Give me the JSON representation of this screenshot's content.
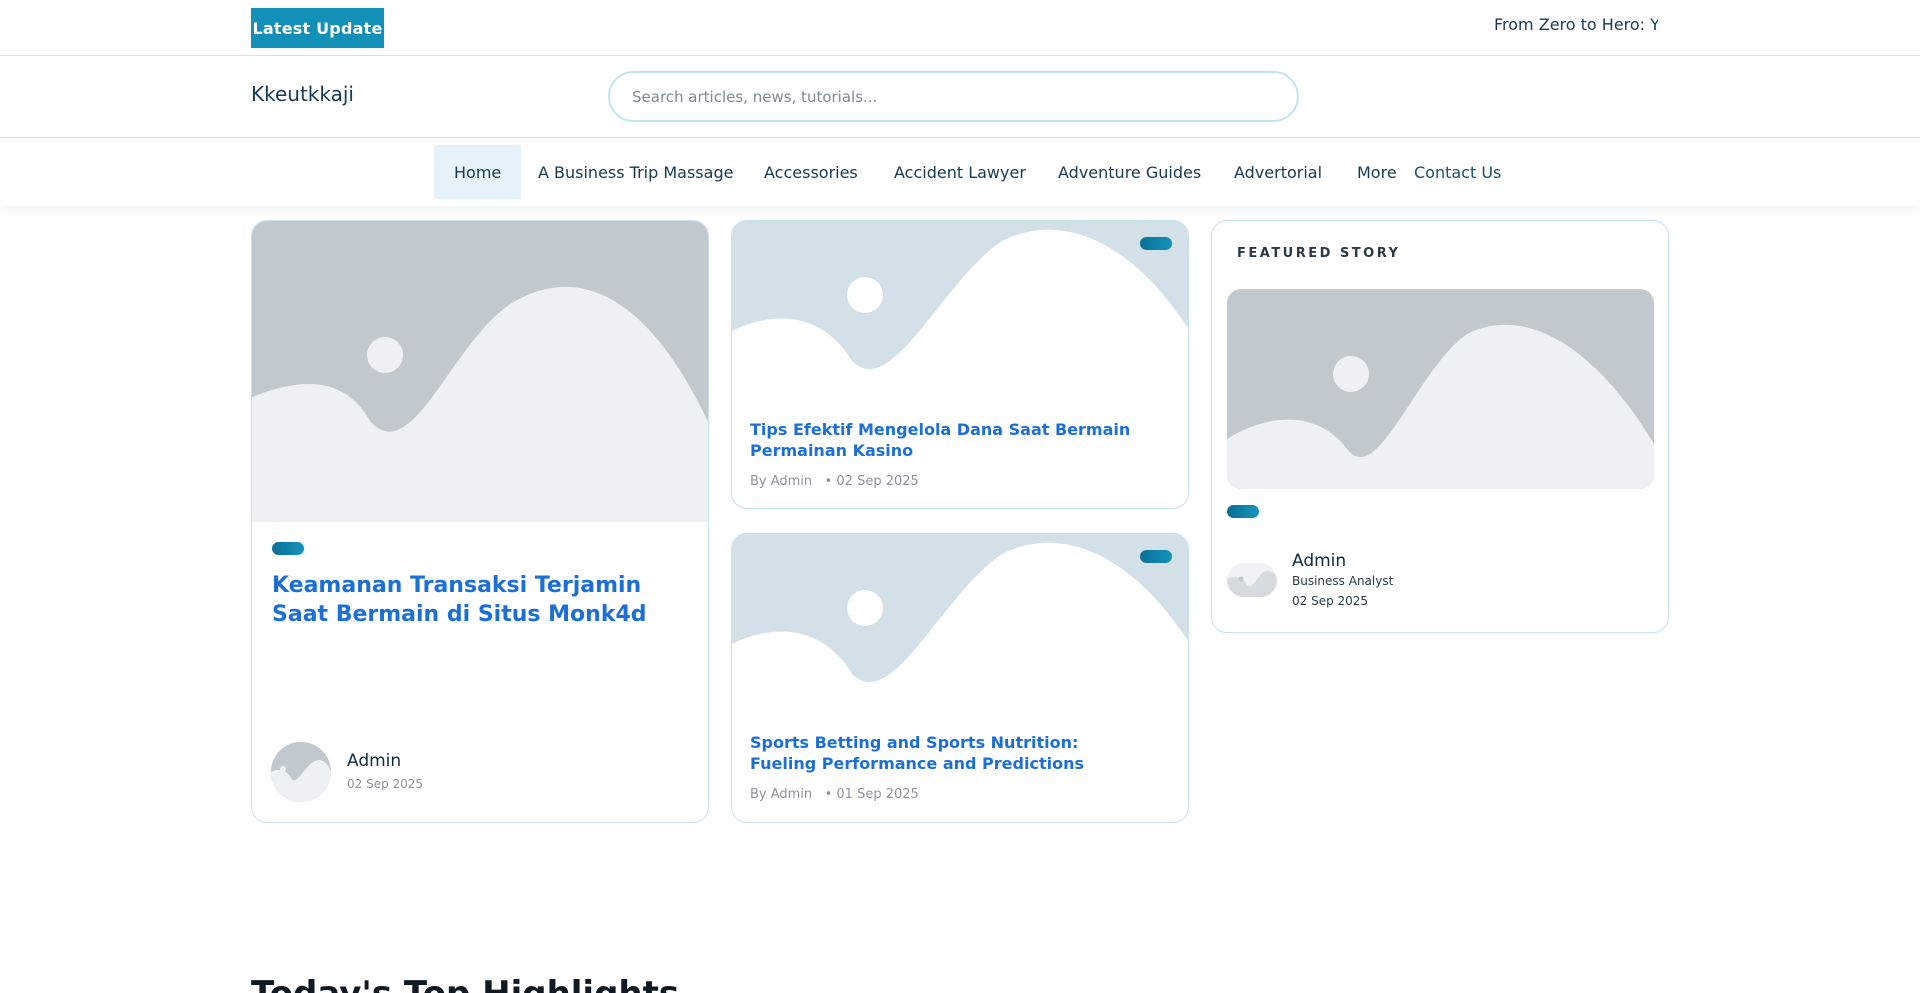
{
  "colors": {
    "accent": "#1290b7",
    "title_link": "#1b6fd6",
    "border": "#c4e3ec",
    "nav_active_bg": "#e6f2f9",
    "placeholder_gray": "#c1c8ce",
    "placeholder_blue": "#d3e0e8"
  },
  "ticker": {
    "badge": "Latest  Update",
    "text": "From Zero to Hero: Yo"
  },
  "header": {
    "site_name": "Kkeutkkaji",
    "search_placeholder": "Search articles, news, tutorials..."
  },
  "nav": {
    "items": [
      {
        "label": "Home",
        "active": true
      },
      {
        "label": "A Business Trip Massage"
      },
      {
        "label": "Accessories"
      },
      {
        "label": "Accident Lawyer"
      },
      {
        "label": "Adventure Guides"
      },
      {
        "label": "Advertorial"
      },
      {
        "label": "More"
      }
    ],
    "contact": "Contact Us"
  },
  "main_post": {
    "title": "Keamanan Transaksi Terjamin Saat Bermain di Situs Monk4d",
    "author": "Admin",
    "date": "02 Sep 2025"
  },
  "side_posts": [
    {
      "title": "Tips Efektif Mengelola Dana Saat Bermain Permainan Kasino",
      "author": "By Admin",
      "date": "• 02 Sep 2025"
    },
    {
      "title": "Sports Betting and Sports Nutrition: Fueling Performance and Predictions",
      "author": "By Admin",
      "date": "• 01 Sep 2025"
    }
  ],
  "featured": {
    "label": "FEATURED STORY",
    "author": "Admin",
    "role": "Business Analyst",
    "date": "02 Sep 2025"
  },
  "section": {
    "title": "Today's Top Highlights"
  },
  "icons": {
    "placeholder": "image-placeholder-icon",
    "avatar": "avatar-placeholder-icon"
  }
}
